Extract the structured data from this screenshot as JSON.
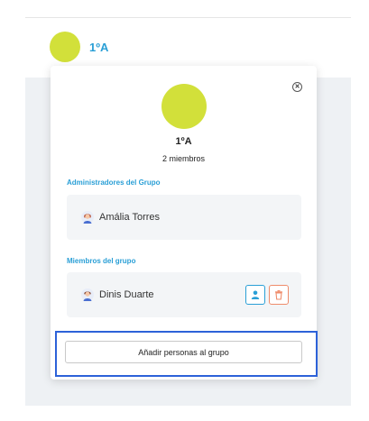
{
  "header": {
    "group_name": "1ºA"
  },
  "popover": {
    "group_name": "1ºA",
    "member_count": "2 miembros",
    "admins_section_title": "Administradores del Grupo",
    "admins": [
      {
        "name": "Amália Torres"
      }
    ],
    "members_section_title": "Miembros del grupo",
    "members": [
      {
        "name": "Dinis Duarte"
      }
    ],
    "add_button_label": "Añadir personas al grupo"
  },
  "colors": {
    "accent_blue": "#2a9fd6",
    "avatar_lime": "#d2e03a",
    "delete_orange": "#ef8c6b",
    "highlight_blue": "#2d62d8"
  }
}
